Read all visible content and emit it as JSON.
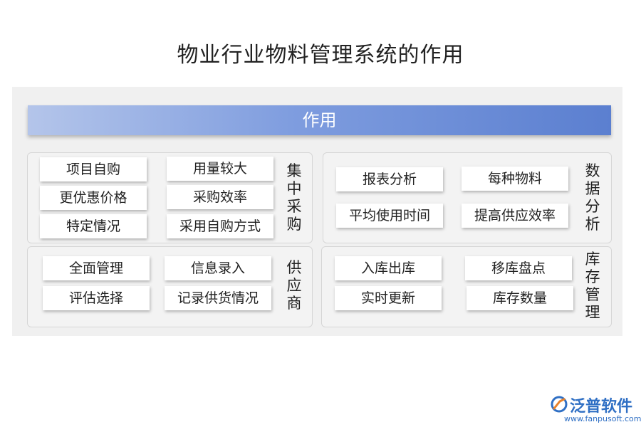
{
  "title": "物业行业物料管理系统的作用",
  "header": "作用",
  "groups": {
    "procurement": {
      "label": "集中采购",
      "items": [
        "项目自购",
        "用量较大",
        "更优惠价格",
        "采购效率",
        "特定情况",
        "采用自购方式"
      ]
    },
    "analysis": {
      "label": "数据分析",
      "items": [
        "报表分析",
        "每种物料",
        "平均使用时间",
        "提高供应效率"
      ]
    },
    "supplier": {
      "label": "供应商",
      "items": [
        "全面管理",
        "信息录入",
        "评估选择",
        "记录供货情况"
      ]
    },
    "inventory": {
      "label": "库存管理",
      "items": [
        "入库出库",
        "移库盘点",
        "实时更新",
        "库存数量"
      ]
    }
  },
  "logo": {
    "name": "泛普软件",
    "url": "www.fanpusoft.com",
    "icon": "fanpu-logo-icon",
    "color": "#2f6fc4"
  }
}
